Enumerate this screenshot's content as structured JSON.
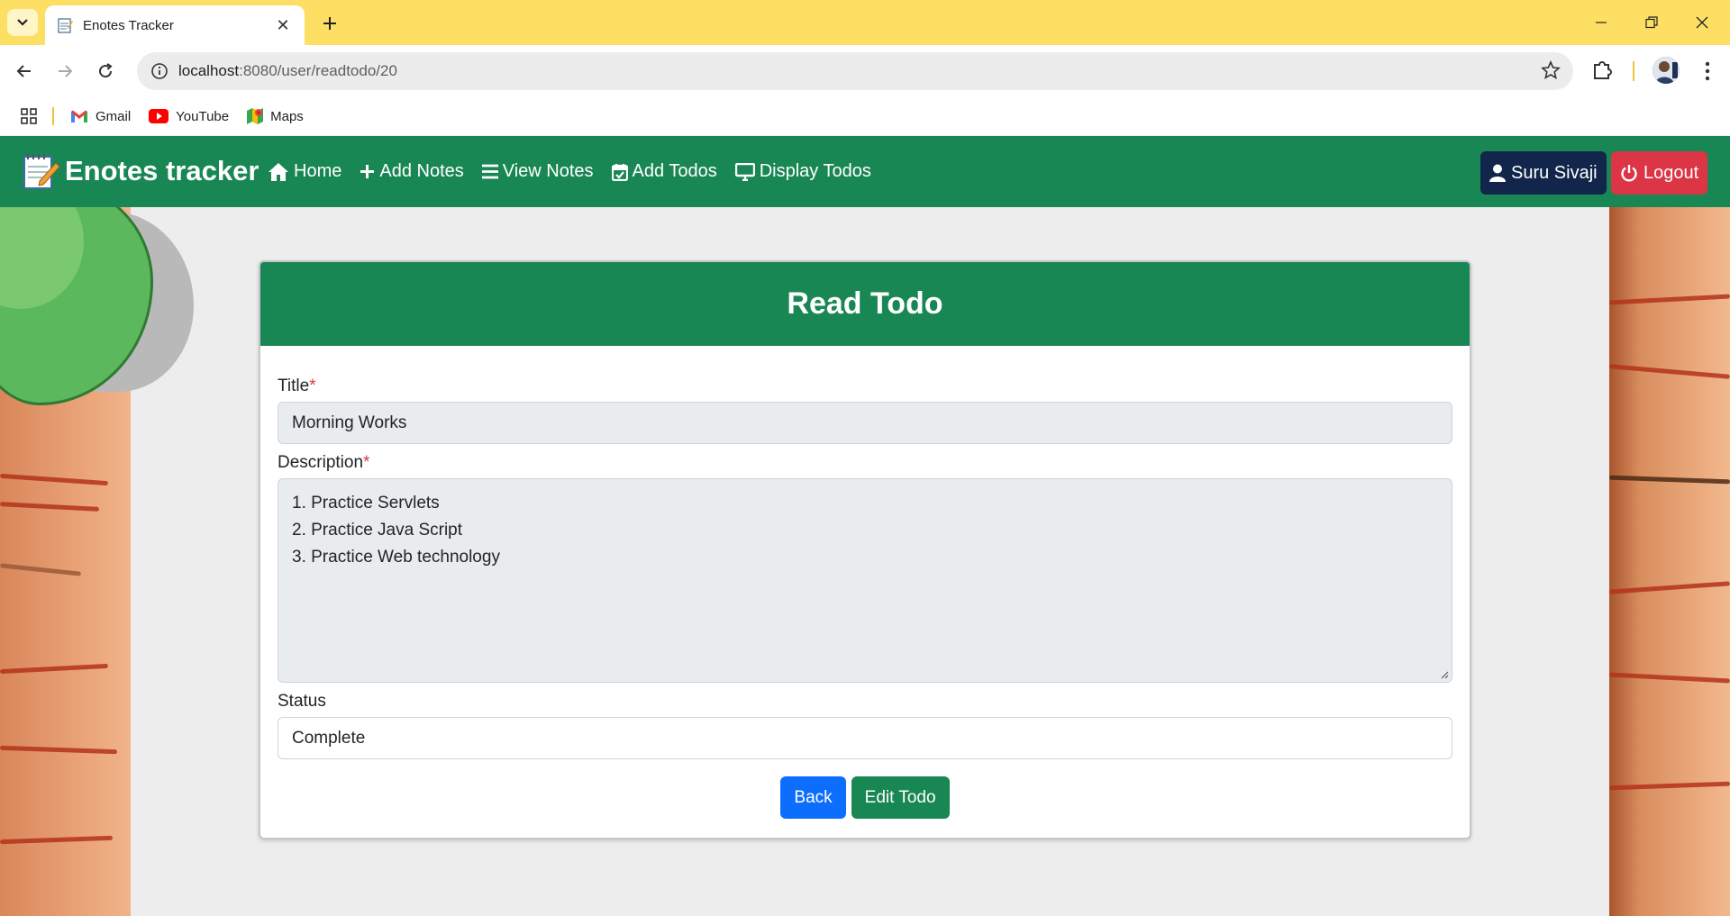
{
  "browser": {
    "tab_title": "Enotes Tracker",
    "url_host": "localhost",
    "url_rest": ":8080/user/readtodo/20",
    "bookmarks": [
      {
        "label": "Gmail",
        "icon": "gmail-icon"
      },
      {
        "label": "YouTube",
        "icon": "youtube-icon"
      },
      {
        "label": "Maps",
        "icon": "maps-icon"
      }
    ]
  },
  "navbar": {
    "brand": "Enotes tracker",
    "links": [
      {
        "label": "Home",
        "icon": "home-icon"
      },
      {
        "label": "Add Notes",
        "icon": "plus-icon"
      },
      {
        "label": "View Notes",
        "icon": "list-icon"
      },
      {
        "label": "Add Todos",
        "icon": "calendar-check-icon"
      },
      {
        "label": "Display Todos",
        "icon": "monitor-icon"
      }
    ],
    "user_name": "Suru Sivaji",
    "logout_label": "Logout",
    "colors": {
      "navbar": "#198754",
      "user_button": "#12254a",
      "logout_button": "#dc3545"
    }
  },
  "form": {
    "heading": "Read Todo",
    "title_label": "Title",
    "title_value": "Morning Works",
    "description_label": "Description",
    "required_mark": "*",
    "description_lines": [
      "1. Practice Servlets",
      "2. Practice Java Script",
      "3. Practice Web technology"
    ],
    "status_label": "Status",
    "status_value": "Complete",
    "back_label": "Back",
    "edit_label": "Edit Todo",
    "colors": {
      "header": "#198754",
      "back": "#0d6efd",
      "edit": "#198754"
    }
  }
}
